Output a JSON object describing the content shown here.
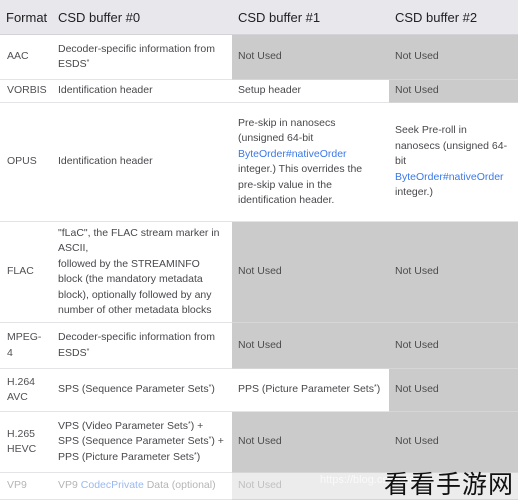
{
  "table": {
    "headers": [
      "Format",
      "CSD buffer #0",
      "CSD buffer #1",
      "CSD buffer #2"
    ],
    "not_used_label": "Not Used",
    "rows": {
      "aac": {
        "format": "AAC",
        "csd0": "Decoder-specific information from ESDS",
        "csd0_sup": "*"
      },
      "vorbis": {
        "format": "VORBIS",
        "csd0": "Identification header",
        "csd1": "Setup header"
      },
      "opus": {
        "format": "OPUS",
        "csd0": "Identification header",
        "csd1_pre": "Pre-skip in nanosecs (unsigned 64-bit ",
        "csd1_link": "ByteOrder#nativeOrder",
        "csd1_post": " integer.) This overrides the pre-skip value in the identification header.",
        "csd2_pre": "Seek Pre-roll in nanosecs (unsigned 64-bit ",
        "csd2_link": "ByteOrder#nativeOrder",
        "csd2_post": " integer.)"
      },
      "flac": {
        "format": "FLAC",
        "csd0_line1": "\"fLaC\", the FLAC stream marker in ASCII,",
        "csd0_line2": "followed by the STREAMINFO block (the mandatory metadata block), optionally followed by any number of other metadata blocks"
      },
      "mpeg4": {
        "format": "MPEG-4",
        "csd0": "Decoder-specific information from ESDS",
        "csd0_sup": "*"
      },
      "h264": {
        "format": "H.264 AVC",
        "csd0": "SPS (Sequence Parameter Sets",
        "csd0_sup": "*",
        "csd0_end": ")",
        "csd1": "PPS (Picture Parameter Sets",
        "csd1_sup": "*",
        "csd1_end": ")"
      },
      "h265": {
        "format": "H.265 HEVC",
        "line1": "VPS (Video Parameter Sets",
        "line1_end": ") +",
        "line2": "SPS (Sequence Parameter Sets",
        "line2_end": ") +",
        "line3": "PPS (Picture Parameter Sets",
        "line3_end": ")",
        "sup": "*"
      },
      "vp9": {
        "format": "VP9",
        "csd0_pre": "VP9 ",
        "csd0_link": "CodecPrivate",
        "csd0_post": " Data (optional)"
      }
    }
  },
  "watermark": {
    "text": "看看手游网",
    "url": "https://blog.csdn.net"
  },
  "colors": {
    "link": "#3b78e7",
    "not_used_bg": "#cbcbcb",
    "header_bg": "#e8e8ec"
  }
}
